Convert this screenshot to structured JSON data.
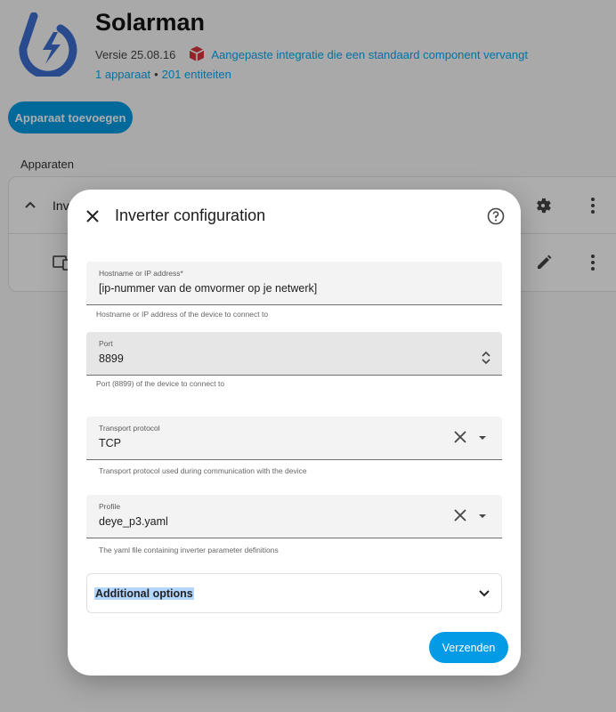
{
  "integration": {
    "title": "Solarman",
    "version": "Versie 25.08.16",
    "custom_notice": "Aangepaste integratie die een standaard component vervangt",
    "device_count": "1 apparaat",
    "separator": "•",
    "entity_count": "201 entiteiten",
    "add_device_label": "Apparaat toevoegen",
    "section_title": "Apparaten",
    "device_name": "Inverter"
  },
  "dialog": {
    "title": "Inverter configuration",
    "fields": {
      "host": {
        "label": "Hostname or IP address*",
        "value": "[ip-nummer van de omvormer op je netwerk]",
        "helper": "Hostname or IP address of the device to connect to"
      },
      "port": {
        "label": "Port",
        "value": "8899",
        "helper": "Port (8899) of the device to connect to"
      },
      "transport": {
        "label": "Transport protocol",
        "value": "TCP",
        "helper": "Transport protocol used during communication with the device"
      },
      "profile": {
        "label": "Profile",
        "value": "deye_p3.yaml",
        "helper": "The yaml file containing inverter parameter definitions"
      }
    },
    "additional_options_label": "Additional options",
    "submit_label": "Verzenden"
  },
  "colors": {
    "accent": "#039be5",
    "link": "#03a9f4",
    "logo": "#3d6fd1",
    "package_icon": "#d9363e"
  },
  "icons": [
    "solarman-logo-icon",
    "package-icon",
    "chevron-up-icon",
    "gear-icon",
    "dots-vertical-icon",
    "device-icon",
    "pencil-icon",
    "close-icon",
    "help-circle-icon",
    "stepper-icon",
    "clear-icon",
    "dropdown-arrow-icon",
    "chevron-down-icon"
  ]
}
